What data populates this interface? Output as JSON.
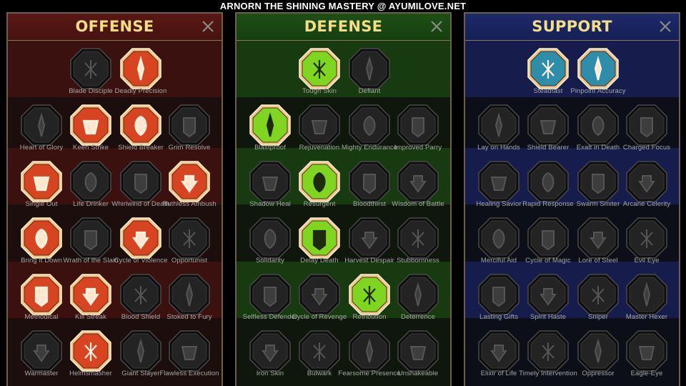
{
  "watermark": "ARNORN THE SHINING MASTERY @ AYUMILOVE.NET",
  "colors": {
    "offense_active": "#d94420",
    "defense_active": "#7fd61e",
    "support_active": "#2c8ea8",
    "inactive": "#2a2a2a",
    "title_gold": "#f3de86",
    "label_grey": "#a6a8a6"
  },
  "panels": [
    {
      "key": "offense",
      "title": "OFFENSE",
      "close_icon": "close-icon",
      "tiers": [
        [
          {
            "name": "Blade Disciple",
            "icon": "crossed-swords-icon",
            "active": false
          },
          {
            "name": "Deadly Precision",
            "icon": "dagger-icon",
            "active": true
          }
        ],
        [
          {
            "name": "Heart of Glory",
            "icon": "horned-warrior-icon",
            "active": false
          },
          {
            "name": "Keen Strike",
            "icon": "slash-strike-icon",
            "active": true
          },
          {
            "name": "Shield Breaker",
            "icon": "broken-shield-icon",
            "active": true
          },
          {
            "name": "Grim Resolve",
            "icon": "bleeding-heart-icon",
            "active": false
          }
        ],
        [
          {
            "name": "Single Out",
            "icon": "arrows-target-icon",
            "active": true
          },
          {
            "name": "Life Drinker",
            "icon": "fanged-mouth-icon",
            "active": false
          },
          {
            "name": "Whirlwind of Death",
            "icon": "whirlwind-icon",
            "active": false
          },
          {
            "name": "Ruthless Ambush",
            "icon": "striking-fist-icon",
            "active": true
          }
        ],
        [
          {
            "name": "Bring it Down",
            "icon": "downward-sword-icon",
            "active": true
          },
          {
            "name": "Wrath of the Slain",
            "icon": "hammer-fist-icon",
            "active": false
          },
          {
            "name": "Cycle of Violence",
            "icon": "axe-icon",
            "active": true
          },
          {
            "name": "Opportunist",
            "icon": "chains-lightning-icon",
            "active": false
          }
        ],
        [
          {
            "name": "Methodical",
            "icon": "explosion-icon",
            "active": true
          },
          {
            "name": "Kill Streak",
            "icon": "skull-icon",
            "active": true
          },
          {
            "name": "Blood Shield",
            "icon": "blade-shield-icon",
            "active": false
          },
          {
            "name": "Stoked to Fury",
            "icon": "raging-warrior-icon",
            "active": false
          }
        ],
        [
          {
            "name": "Warmaster",
            "icon": "falling-sword-icon",
            "active": false
          },
          {
            "name": "Helmsmasher",
            "icon": "knight-helm-icon",
            "active": true
          },
          {
            "name": "Giant Slayer",
            "icon": "giant-icon",
            "active": false
          },
          {
            "name": "Flawless Execution",
            "icon": "executioner-skull-icon",
            "active": false
          }
        ]
      ]
    },
    {
      "key": "defense",
      "title": "DEFENSE",
      "close_icon": "close-icon",
      "tiers": [
        [
          {
            "name": "Tough Skin",
            "icon": "scales-icon",
            "active": true
          },
          {
            "name": "Defiant",
            "icon": "raised-fist-icon",
            "active": false
          }
        ],
        [
          {
            "name": "Blastproof",
            "icon": "chevron-shield-icon",
            "active": true
          },
          {
            "name": "Rejuvenation",
            "icon": "heart-hand-icon",
            "active": false
          },
          {
            "name": "Mighty Endurance",
            "icon": "muscle-man-icon",
            "active": false
          },
          {
            "name": "Improved Parry",
            "icon": "parry-blades-icon",
            "active": false
          }
        ],
        [
          {
            "name": "Shadow Heal",
            "icon": "shadow-figure-icon",
            "active": false
          },
          {
            "name": "Resurgent",
            "icon": "shield-knight-icon",
            "active": true
          },
          {
            "name": "Bloodthirst",
            "icon": "heart-skull-icon",
            "active": false
          },
          {
            "name": "Wisdom of Battle",
            "icon": "hooded-sage-icon",
            "active": false
          }
        ],
        [
          {
            "name": "Solidarity",
            "icon": "raised-hands-icon",
            "active": false
          },
          {
            "name": "Delay Death",
            "icon": "hourglass-icon",
            "active": true
          },
          {
            "name": "Harvest Despair",
            "icon": "open-palm-icon",
            "active": false
          },
          {
            "name": "Stubbornness",
            "icon": "bull-skull-icon",
            "active": false
          }
        ],
        [
          {
            "name": "Selfless Defender",
            "icon": "running-defender-icon",
            "active": false
          },
          {
            "name": "Cycle of Revenge",
            "icon": "blood-drops-icon",
            "active": false
          },
          {
            "name": "Retribution",
            "icon": "radiant-skull-icon",
            "active": true
          },
          {
            "name": "Deterrence",
            "icon": "deflect-shield-icon",
            "active": false
          }
        ],
        [
          {
            "name": "Iron Skin",
            "icon": "armored-head-icon",
            "active": false
          },
          {
            "name": "Bulwark",
            "icon": "tower-shield-icon",
            "active": false
          },
          {
            "name": "Fearsome Presence",
            "icon": "screaming-face-icon",
            "active": false
          },
          {
            "name": "Unshakeable",
            "icon": "flexing-figure-icon",
            "active": false
          }
        ]
      ]
    },
    {
      "key": "support",
      "title": "SUPPORT",
      "close_icon": "close-icon",
      "tiers": [
        [
          {
            "name": "Steadfast",
            "icon": "hands-heart-icon",
            "active": true
          },
          {
            "name": "Pinpoint Accuracy",
            "icon": "bullseye-arrow-icon",
            "active": true
          }
        ],
        [
          {
            "name": "Lay on Hands",
            "icon": "praying-hands-icon",
            "active": false
          },
          {
            "name": "Shield Bearer",
            "icon": "shield-aura-icon",
            "active": false
          },
          {
            "name": "Exalt in Death",
            "icon": "flaming-skull-icon",
            "active": false
          },
          {
            "name": "Charged Focus",
            "icon": "charged-hand-icon",
            "active": false
          }
        ],
        [
          {
            "name": "Healing Savior",
            "icon": "healing-figure-icon",
            "active": false
          },
          {
            "name": "Rapid Response",
            "icon": "lightning-bolt-icon",
            "active": false
          },
          {
            "name": "Swarm Smiter",
            "icon": "swarm-icon",
            "active": false
          },
          {
            "name": "Arcane Celerity",
            "icon": "arcane-figure-icon",
            "active": false
          }
        ],
        [
          {
            "name": "Merciful Aid",
            "icon": "chained-heart-icon",
            "active": false
          },
          {
            "name": "Cycle of Magic",
            "icon": "comet-icon",
            "active": false
          },
          {
            "name": "Lore of Steel",
            "icon": "open-book-icon",
            "active": false
          },
          {
            "name": "Evil Eye",
            "icon": "evil-eye-icon",
            "active": false
          }
        ],
        [
          {
            "name": "Lasting Gifts",
            "icon": "compass-star-icon",
            "active": false
          },
          {
            "name": "Spirit Haste",
            "icon": "winged-boot-icon",
            "active": false
          },
          {
            "name": "Sniper",
            "icon": "eye-icon",
            "active": false
          },
          {
            "name": "Master Hexer",
            "icon": "hex-totem-icon",
            "active": false
          }
        ],
        [
          {
            "name": "Elixir of Life",
            "icon": "potion-flask-icon",
            "active": false
          },
          {
            "name": "Timely Intervention",
            "icon": "demon-skull-icon",
            "active": false
          },
          {
            "name": "Oppressor",
            "icon": "crushing-gauntlet-icon",
            "active": false
          },
          {
            "name": "Eagle-Eye",
            "icon": "eagle-head-icon",
            "active": false
          }
        ]
      ]
    }
  ]
}
